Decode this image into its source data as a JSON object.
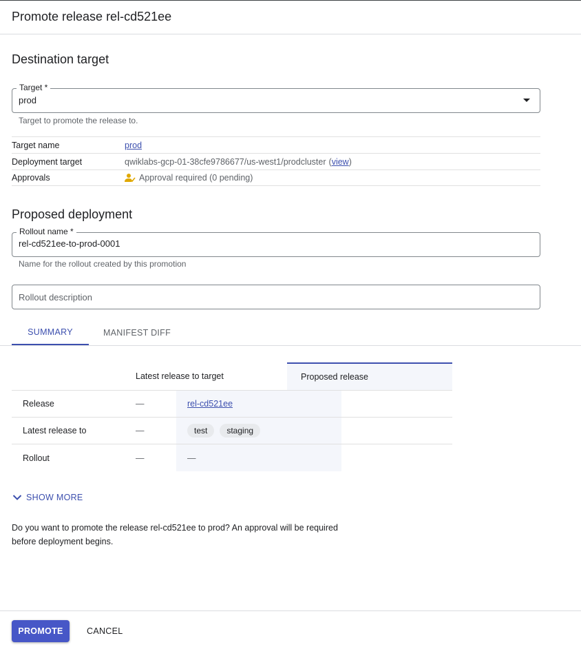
{
  "dialog": {
    "title": "Promote release rel-cd521ee"
  },
  "destination": {
    "section_title": "Destination target",
    "target_label": "Target *",
    "target_value": "prod",
    "target_hint": "Target to promote the release to.",
    "details": {
      "target_name_key": "Target name",
      "target_name_value": "prod",
      "deployment_target_key": "Deployment target",
      "deployment_target_value": "qwiklabs-gcp-01-38cfe9786677/us-west1/prodcluster",
      "view_open": "(",
      "view_link": "view",
      "view_close": ")",
      "approvals_key": "Approvals",
      "approvals_value": "Approval required (0 pending)"
    }
  },
  "proposed": {
    "section_title": "Proposed deployment",
    "rollout_name_label": "Rollout name *",
    "rollout_name_value": "rel-cd521ee-to-prod-0001",
    "rollout_name_hint": "Name for the rollout created by this promotion",
    "rollout_description_placeholder": "Rollout description"
  },
  "tabs": [
    {
      "label": "SUMMARY",
      "active": true
    },
    {
      "label": "MANIFEST DIFF",
      "active": false
    }
  ],
  "summary_table": {
    "headers": [
      "",
      "Latest release to target",
      "Proposed release"
    ],
    "rows": {
      "release": {
        "label": "Release",
        "latest": "—",
        "proposed": "rel-cd521ee"
      },
      "latest_release_to": {
        "label": "Latest release to",
        "latest": "—",
        "proposed_chips": [
          "test",
          "staging"
        ]
      },
      "rollout": {
        "label": "Rollout",
        "latest": "—",
        "proposed": "—"
      }
    }
  },
  "show_more_label": "SHOW MORE",
  "message": "Do you want to promote the release rel-cd521ee to prod? An approval will be required before deployment begins.",
  "footer": {
    "promote_label": "PROMOTE",
    "cancel_label": "CANCEL"
  },
  "colors": {
    "accent": "#4757c7",
    "link": "#3c4fae",
    "approval_icon": "#e0a800"
  }
}
